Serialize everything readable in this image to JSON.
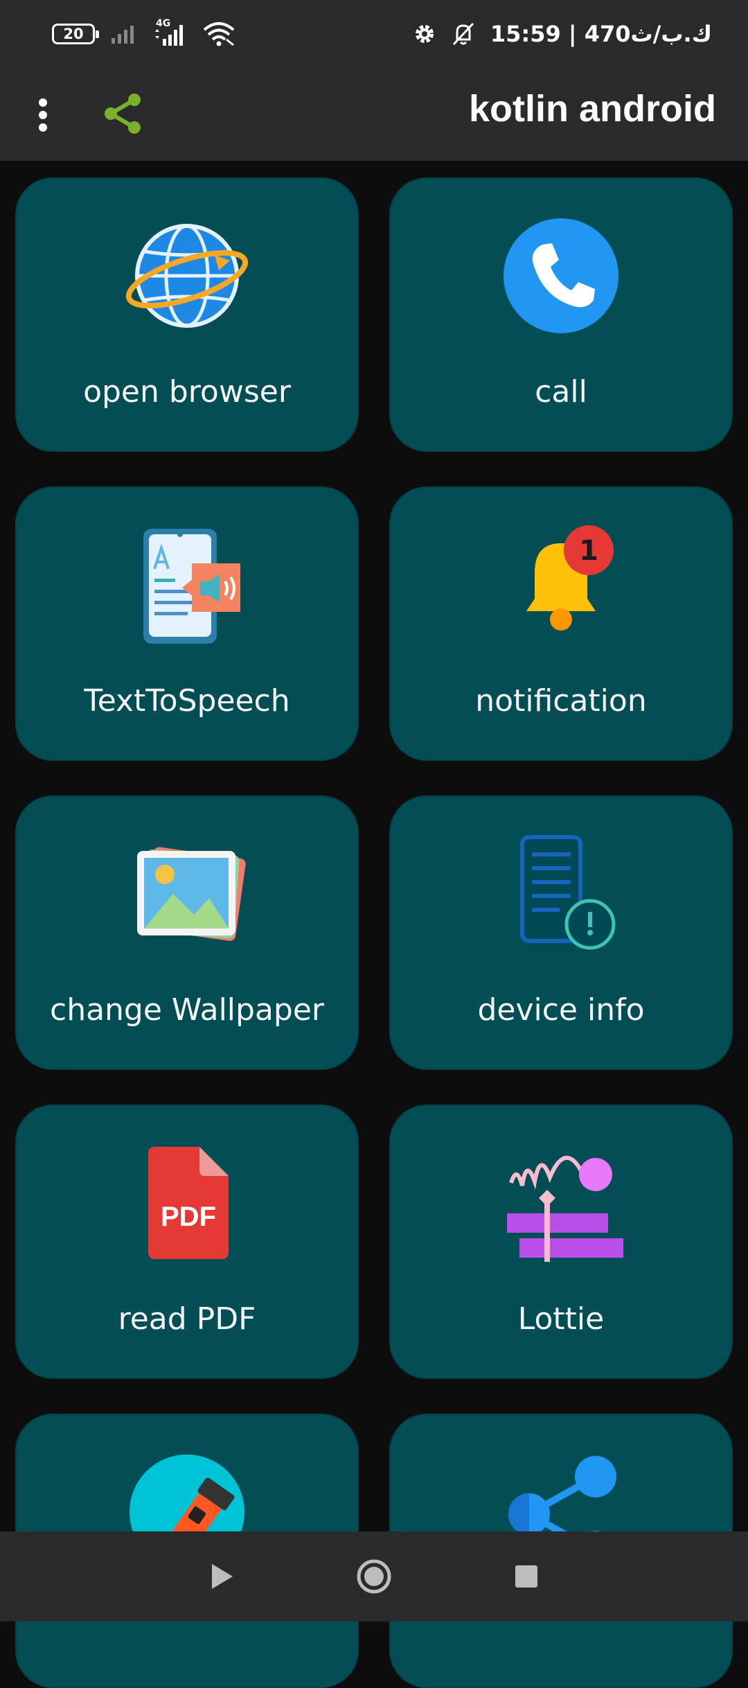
{
  "status_bar": {
    "battery": "20",
    "network": "4G",
    "right_text": "15:59 | 470ك.ب/ث",
    "icons": [
      "battery-icon",
      "signal-icon",
      "signal-4g-icon",
      "wifi-icon",
      "settings-icon",
      "bell-off-icon"
    ]
  },
  "app_bar": {
    "title": "kotlin android",
    "icons": [
      "more-vert-icon",
      "share-icon"
    ],
    "share_color": "#7bb02a"
  },
  "grid": {
    "items": [
      {
        "label": "open browser",
        "icon": "globe-icon"
      },
      {
        "label": "call",
        "icon": "phone-icon"
      },
      {
        "label": "TextToSpeech",
        "icon": "text-to-speech-icon"
      },
      {
        "label": "notification",
        "icon": "notification-bell-icon"
      },
      {
        "label": "change Wallpaper",
        "icon": "wallpaper-image-icon"
      },
      {
        "label": "device info",
        "icon": "device-info-icon"
      },
      {
        "label": "read PDF",
        "icon": "pdf-file-icon"
      },
      {
        "label": "Lottie",
        "icon": "lottie-animation-icon"
      },
      {
        "label": "",
        "icon": "flashlight-icon"
      },
      {
        "label": "",
        "icon": "share-nodes-icon"
      }
    ],
    "pdf_badge_text": "PDF",
    "notification_count": "1",
    "card_color": "#034d55"
  },
  "nav_bar": {
    "icons": [
      "back-triangle-icon",
      "home-circle-icon",
      "recents-square-icon"
    ]
  }
}
